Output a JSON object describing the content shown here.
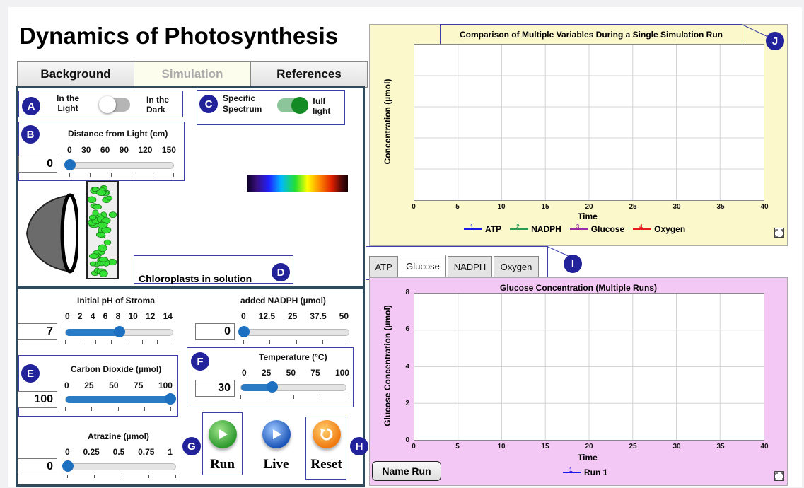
{
  "title": "Dynamics of Photosynthesis",
  "nav": {
    "background": "Background",
    "simulation": "Simulation",
    "references": "References"
  },
  "badges": {
    "a": "A",
    "b": "B",
    "c": "C",
    "d": "D",
    "e": "E",
    "f": "F",
    "g": "G",
    "h": "H",
    "i": "I",
    "j": "J"
  },
  "light_toggle": {
    "left_1": "In the",
    "left_2": "Light",
    "right_1": "In the",
    "right_2": "Dark",
    "state": "light"
  },
  "spectrum_toggle": {
    "left_1": "Specific",
    "left_2": "Spectrum",
    "right_1": "full",
    "right_2": "light",
    "state": "full light"
  },
  "distance": {
    "label": "Distance from Light (cm)",
    "ticks": [
      "0",
      "30",
      "60",
      "90",
      "120",
      "150"
    ],
    "value": "0",
    "min": 0,
    "max": 150,
    "current": 0
  },
  "chloroplasts_label": "Chloroplasts in solution",
  "ph": {
    "label": "Initial pH of Stroma",
    "ticks": [
      "0",
      "2",
      "4",
      "6",
      "8",
      "10",
      "12",
      "14"
    ],
    "value": "7",
    "min": 0,
    "max": 14,
    "current": 7
  },
  "nadph": {
    "label": "added NADPH (µmol)",
    "ticks": [
      "0",
      "12.5",
      "25",
      "37.5",
      "50"
    ],
    "value": "0",
    "min": 0,
    "max": 50,
    "current": 0
  },
  "co2": {
    "label": "Carbon Dioxide (µmol)",
    "ticks": [
      "0",
      "25",
      "50",
      "75",
      "100"
    ],
    "value": "100",
    "min": 0,
    "max": 100,
    "current": 100
  },
  "temperature": {
    "label": "Temperature (°C)",
    "ticks": [
      "0",
      "25",
      "50",
      "75",
      "100"
    ],
    "value": "30",
    "min": 0,
    "max": 100,
    "current": 30
  },
  "atrazine": {
    "label": "Atrazine (µmol)",
    "ticks": [
      "0",
      "0.25",
      "0.5",
      "0.75",
      "1"
    ],
    "value": "0",
    "min": 0,
    "max": 1,
    "current": 0
  },
  "controls": {
    "run": "Run",
    "live": "Live",
    "reset": "Reset"
  },
  "name_run": "Name Run",
  "tabs": [
    {
      "label": "ATP",
      "active": false
    },
    {
      "label": "Glucose",
      "active": true
    },
    {
      "label": "NADPH",
      "active": false
    },
    {
      "label": "Oxygen",
      "active": false
    }
  ],
  "colors": {
    "atp": "#1a1ae6",
    "nadph": "#2a9a55",
    "glucose": "#9a2aa8",
    "oxygen": "#e61a1a",
    "run1": "#1a1ae6",
    "top_bg": "#fbf8cc",
    "bottom_bg": "#f4c8f4"
  },
  "chart_data": [
    {
      "type": "line",
      "title": "Comparison of Multiple Variables During a Single Simulation Run",
      "xlabel": "Time",
      "ylabel": "Concentration (µmol)",
      "x_ticks": [
        "0",
        "5",
        "10",
        "15",
        "20",
        "25",
        "30",
        "35",
        "40"
      ],
      "y_ticks": [],
      "xlim": [
        0,
        40
      ],
      "grid": true,
      "legend_position": "bottom",
      "series": [
        {
          "name": "ATP",
          "marker": "1",
          "values": []
        },
        {
          "name": "NADPH",
          "marker": "2",
          "values": []
        },
        {
          "name": "Glucose",
          "marker": "3",
          "values": []
        },
        {
          "name": "Oxygen",
          "marker": "4",
          "values": []
        }
      ]
    },
    {
      "type": "line",
      "title": "Glucose Concentration (Multiple Runs)",
      "xlabel": "Time",
      "ylabel": "Glucose Concentration (µmol)",
      "x_ticks": [
        "0",
        "5",
        "10",
        "15",
        "20",
        "25",
        "30",
        "35",
        "40"
      ],
      "y_ticks": [
        "0",
        "2",
        "4",
        "6",
        "8"
      ],
      "xlim": [
        0,
        40
      ],
      "ylim": [
        0,
        8
      ],
      "grid": true,
      "legend_position": "bottom",
      "series": [
        {
          "name": "Run 1",
          "marker": "1",
          "values": []
        }
      ]
    }
  ]
}
